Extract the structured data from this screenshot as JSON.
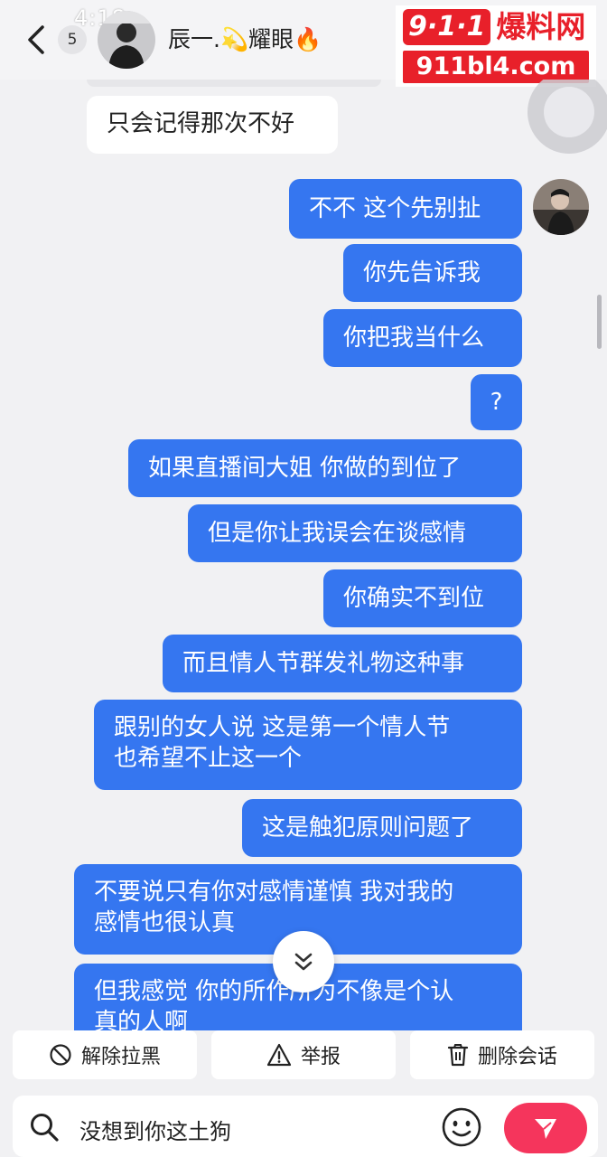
{
  "status": {
    "time": "4:18"
  },
  "header": {
    "unread_count": "5",
    "contact_name": "辰一.💫耀眼🔥",
    "action": "⋯"
  },
  "watermark": {
    "logo_number": "9·1·1",
    "logo_text": "爆料网",
    "url": "911bl4.com"
  },
  "messages": [
    {
      "from": "them",
      "text": "只会记得那次不好"
    },
    {
      "from": "me",
      "text": "不不 这个先别扯"
    },
    {
      "from": "me",
      "text": "你先告诉我"
    },
    {
      "from": "me",
      "text": "你把我当什么"
    },
    {
      "from": "me",
      "text": "?"
    },
    {
      "from": "me",
      "text": "如果直播间大姐 你做的到位了"
    },
    {
      "from": "me",
      "text": "但是你让我误会在谈感情"
    },
    {
      "from": "me",
      "text": "你确实不到位"
    },
    {
      "from": "me",
      "text": "而且情人节群发礼物这种事"
    },
    {
      "from": "me",
      "line1": "跟别的女人说 这是第一个情人节",
      "line2": "也希望不止这一个"
    },
    {
      "from": "me",
      "text": "这是触犯原则问题了"
    },
    {
      "from": "me",
      "line1": "不要说只有你对感情谨慎 我对我的",
      "line2": "感情也很认真"
    },
    {
      "from": "me",
      "line1": "但我感觉 你的所作所为不像是个认",
      "line2": "真的人啊"
    }
  ],
  "actions": {
    "unblock": "解除拉黑",
    "report": "举报",
    "delete_chat": "删除会话"
  },
  "input": {
    "value": "没想到你这土狗"
  },
  "colors": {
    "bubble_out": "#3576f0",
    "bubble_in": "#ffffff",
    "send": "#f5355c",
    "watermark": "#e8202a"
  }
}
